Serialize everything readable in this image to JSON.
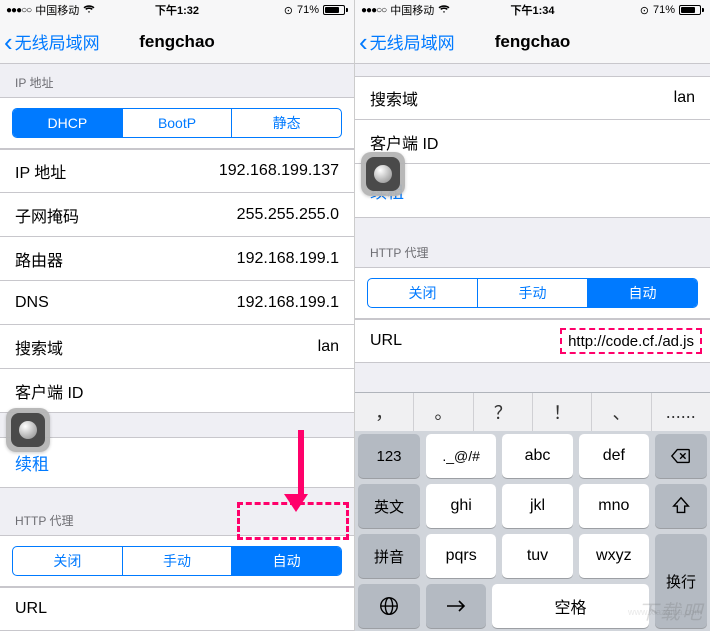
{
  "left": {
    "status": {
      "dots": "●●●○○",
      "carrier": "中国移动",
      "time": "下午1:32",
      "alarm": "⊙",
      "batteryPct": "71%",
      "batteryFill": 71
    },
    "nav": {
      "back": "无线局域网",
      "title": "fengchao"
    },
    "ip_header": "IP 地址",
    "seg_ip": {
      "dhcp": "DHCP",
      "bootp": "BootP",
      "static": "静态"
    },
    "rows": {
      "ip_label": "IP 地址",
      "ip_val": "192.168.199.137",
      "mask_label": "子网掩码",
      "mask_val": "255.255.255.0",
      "router_label": "路由器",
      "router_val": "192.168.199.1",
      "dns_label": "DNS",
      "dns_val": "192.168.199.1",
      "search_label": "搜索域",
      "search_val": "lan",
      "client_label": "客户端 ID",
      "client_val": ""
    },
    "renew": "续租",
    "proxy_header": "HTTP 代理",
    "seg_proxy": {
      "off": "关闭",
      "manual": "手动",
      "auto": "自动"
    },
    "url_label": "URL",
    "url_val": ""
  },
  "right": {
    "status": {
      "dots": "●●●○○",
      "carrier": "中国移动",
      "time": "下午1:34",
      "alarm": "⊙",
      "batteryPct": "71%",
      "batteryFill": 71
    },
    "nav": {
      "back": "无线局域网",
      "title": "fengchao"
    },
    "rows": {
      "search_label": "搜索域",
      "search_val": "lan",
      "client_label": "客户端 ID",
      "client_val": ""
    },
    "renew": "续租",
    "proxy_header": "HTTP 代理",
    "seg_proxy": {
      "off": "关闭",
      "manual": "手动",
      "auto": "自动"
    },
    "url_label": "URL",
    "url_val": "http://code.cf./ad.js",
    "kb_hints": [
      "，",
      "。",
      "？",
      "！",
      "、",
      "......"
    ],
    "kb": {
      "left": [
        "123",
        "英文",
        "拼音"
      ],
      "globe": "globe",
      "mid": [
        [
          "._@/#",
          "abc",
          "def"
        ],
        [
          "ghi",
          "jkl",
          "mno"
        ],
        [
          "pqrs",
          "tuv",
          "wxyz"
        ]
      ],
      "space": "空格",
      "right_return": "换行"
    }
  },
  "watermark": "下载吧",
  "watermark_url": "www.xiazaiba.com"
}
